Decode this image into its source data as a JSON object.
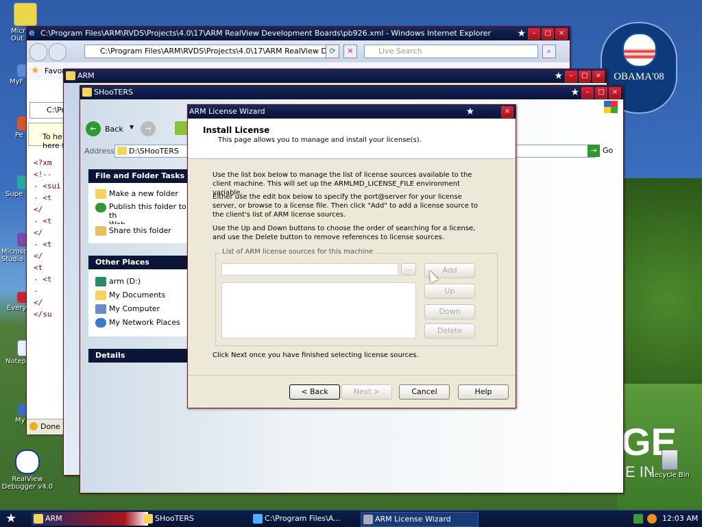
{
  "desktop": {
    "icons": [
      {
        "label": "Micr\nOut"
      },
      {
        "label": "MyF"
      },
      {
        "label": "Pe"
      },
      {
        "label": "Supe"
      },
      {
        "label": "Microso\nStudio"
      },
      {
        "label": "Every"
      },
      {
        "label": "Notep"
      },
      {
        "label": "My"
      },
      {
        "label": "RealView\nDebugger v4.0"
      },
      {
        "label": "Recycle Bin"
      }
    ],
    "poster_text": "OBAMA'08",
    "wallpaper_text": "GE",
    "wallpaper_text2": "E IN"
  },
  "ie": {
    "title": "C:\\Program Files\\ARM\\RVDS\\Projects\\4.0\\17\\ARM RealView Development Boards\\pb926.xml - Windows Internet Explorer",
    "address": "C:\\Program Files\\ARM\\RVDS\\Projects\\4.0\\17\\ARM RealView Dev",
    "search_placeholder": "Live Search",
    "favorites": "Favor",
    "tab": "C:\\Pr",
    "info_bar": "To hel\nhere f",
    "xml_lines": [
      "<?xm",
      "<!--",
      "- <sui",
      "- <t",
      "</",
      "- <t",
      "</",
      "- <t",
      "</",
      "<t",
      "- <t",
      "-",
      "</",
      "</su"
    ],
    "status": "Done"
  },
  "arm_window": {
    "title": "ARM"
  },
  "shooters": {
    "title": "SHooTERS",
    "back": "Back",
    "address_label": "Address",
    "address_value": "D:\\SHooTERS",
    "go": "Go",
    "tasks_header": "File and Folder Tasks",
    "tasks": [
      "Make a new folder",
      "Publish this folder to th\nWeb",
      "Share this folder"
    ],
    "places_header": "Other Places",
    "places": [
      "arm (D:)",
      "My Documents",
      "My Computer",
      "My Network Places"
    ],
    "details_header": "Details"
  },
  "wizard": {
    "title": "ARM License Wizard",
    "heading": "Install License",
    "subheading": "This page allows you to manage and install your license(s).",
    "para1": "Use the list box below to manage the list of license sources available to the client machine. This will set up the ARMLMD_LICENSE_FILE environment variable.",
    "para2": "Either use the edit box below to specify the port@server for your license server, or browse to a license file. Then click \"Add\" to add a license source to the client's list of ARM license sources.",
    "para3": "Use the Up and Down buttons to choose the order of searching for a license, and use the Delete button to remove references to license sources.",
    "group_label": "List of ARM license sources for this machine",
    "browse": "...",
    "add": "Add",
    "up": "Up",
    "down": "Down",
    "delete": "Delete",
    "footer_note": "Click Next once you have finished selecting license sources.",
    "back": "< Back",
    "next": "Next >",
    "cancel": "Cancel",
    "help": "Help"
  },
  "taskbar": {
    "tasks": [
      "ARM",
      "SHooTERS",
      "C:\\Program Files\\A...",
      "ARM License Wizard"
    ],
    "clock": "12:03 AM"
  }
}
